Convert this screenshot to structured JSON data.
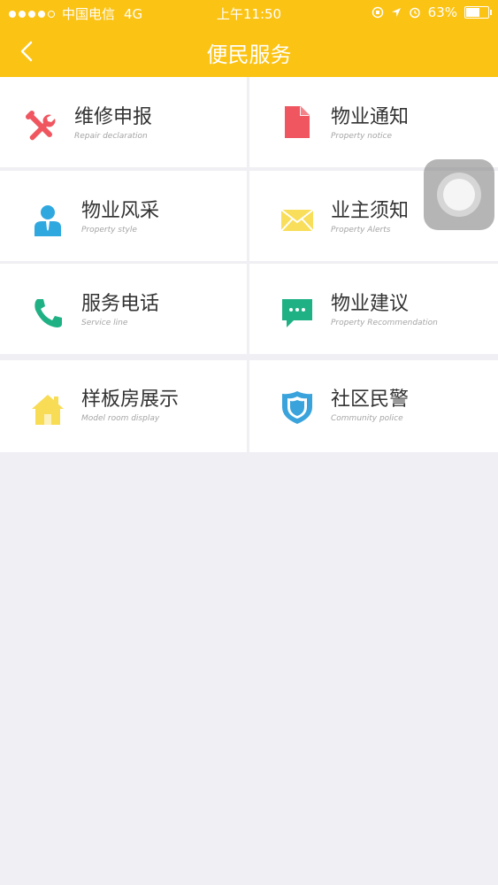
{
  "status_bar": {
    "carrier": "中国电信",
    "network": "4G",
    "time": "上午11:50",
    "battery": "63%",
    "battery_level": 0.63
  },
  "nav": {
    "title": "便民服务"
  },
  "services": [
    {
      "title": "维修申报",
      "subtitle": "Repair declaration",
      "icon": "wrench-icon",
      "color": "#f0565f"
    },
    {
      "title": "物业通知",
      "subtitle": "Property notice",
      "icon": "document-icon",
      "color": "#f0565f"
    },
    {
      "title": "物业风采",
      "subtitle": "Property style",
      "icon": "person-icon",
      "color": "#2fa8df"
    },
    {
      "title": "业主须知",
      "subtitle": "Property Alerts",
      "icon": "envelope-icon",
      "color": "#f8de5a"
    },
    {
      "title": "服务电话",
      "subtitle": "Service line",
      "icon": "phone-icon",
      "color": "#1fb184"
    },
    {
      "title": "物业建议",
      "subtitle": "Property Recommendation",
      "icon": "chat-icon",
      "color": "#1fb184"
    },
    {
      "title": "样板房展示",
      "subtitle": "Model room display",
      "icon": "house-icon",
      "color": "#f9dc55"
    },
    {
      "title": "社区民警",
      "subtitle": "Community police",
      "icon": "shield-icon",
      "color": "#3aa3dc"
    }
  ]
}
